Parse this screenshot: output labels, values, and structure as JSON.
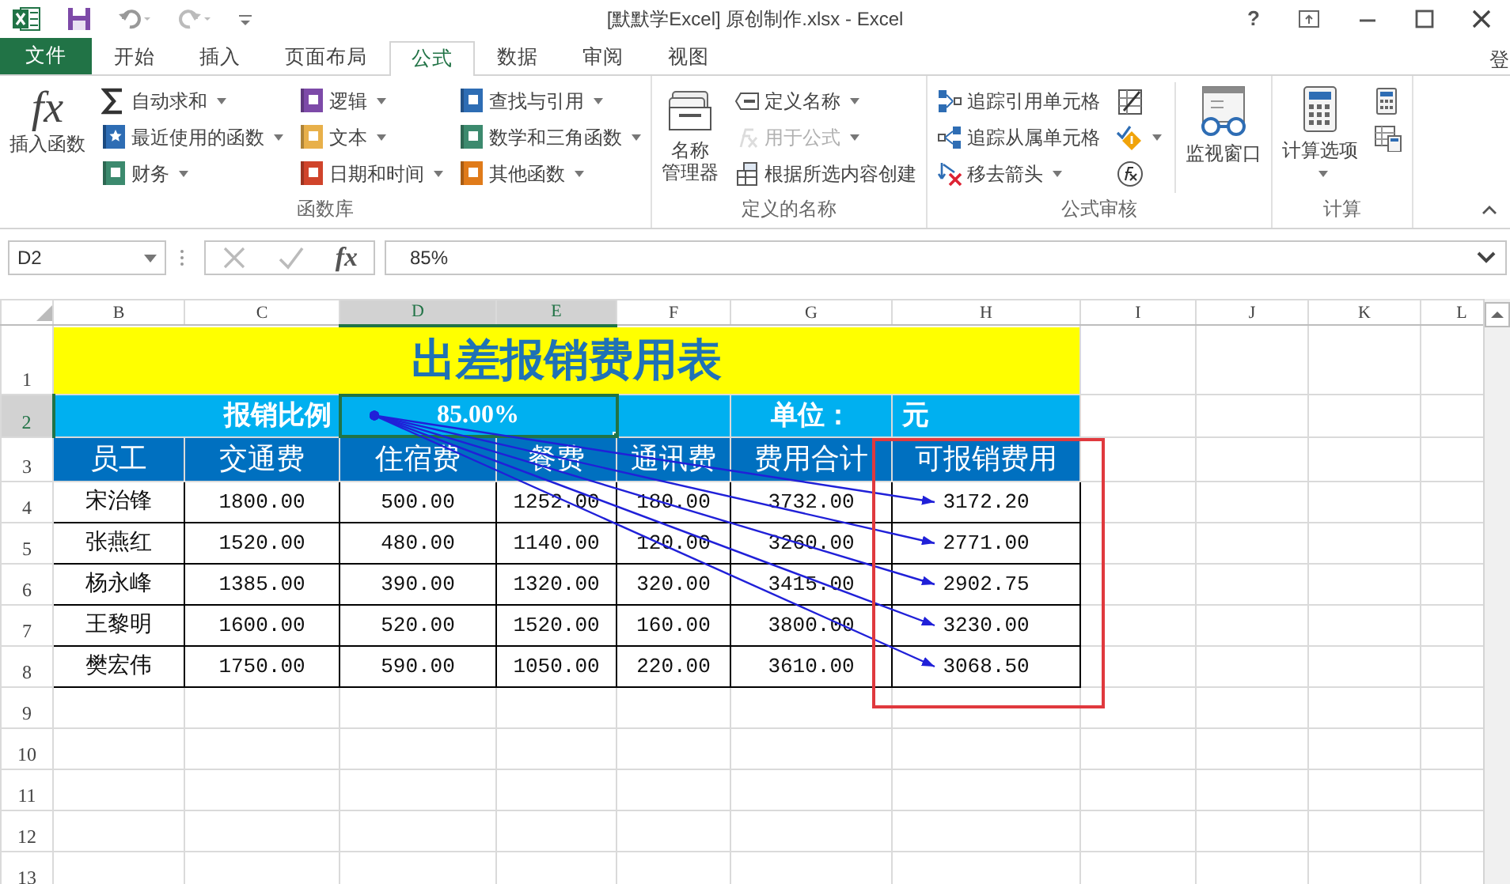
{
  "window": {
    "title": "[默默学Excel] 原创制作.xlsx - Excel",
    "help": "?",
    "account": "登"
  },
  "tabs": [
    {
      "label": "文件",
      "kind": "file",
      "selected": false
    },
    {
      "label": "开始",
      "kind": "tab",
      "selected": false
    },
    {
      "label": "插入",
      "kind": "tab",
      "selected": false
    },
    {
      "label": "页面布局",
      "kind": "tab",
      "selected": false
    },
    {
      "label": "公式",
      "kind": "tab",
      "selected": true
    },
    {
      "label": "数据",
      "kind": "tab",
      "selected": false
    },
    {
      "label": "审阅",
      "kind": "tab",
      "selected": false
    },
    {
      "label": "视图",
      "kind": "tab",
      "selected": false
    }
  ],
  "ribbon": {
    "groups": [
      {
        "label": "函数库",
        "blocks": [
          {
            "kind": "large",
            "glyph": "fx",
            "lines": [
              "插入函数"
            ],
            "dropdown": false
          },
          {
            "kind": "stack",
            "items": [
              {
                "label": "自动求和",
                "dropdown": true,
                "disabled": false
              },
              {
                "label": "最近使用的函数",
                "dropdown": true,
                "disabled": false
              },
              {
                "label": "财务",
                "dropdown": true,
                "disabled": false
              }
            ]
          },
          {
            "kind": "stack",
            "items": [
              {
                "label": "逻辑",
                "dropdown": true,
                "disabled": false
              },
              {
                "label": "文本",
                "dropdown": true,
                "disabled": false
              },
              {
                "label": "日期和时间",
                "dropdown": true,
                "disabled": false
              }
            ]
          },
          {
            "kind": "stack",
            "items": [
              {
                "label": "查找与引用",
                "dropdown": true,
                "disabled": false
              },
              {
                "label": "数学和三角函数",
                "dropdown": true,
                "disabled": false
              },
              {
                "label": "其他函数",
                "dropdown": true,
                "disabled": false
              }
            ]
          }
        ]
      },
      {
        "label": "定义的名称",
        "blocks": [
          {
            "kind": "large",
            "lines": [
              "名称",
              "管理器"
            ],
            "dropdown": false
          },
          {
            "kind": "stack",
            "items": [
              {
                "label": "定义名称",
                "dropdown": true,
                "disabled": false
              },
              {
                "label": "用于公式",
                "dropdown": true,
                "disabled": true
              },
              {
                "label": "根据所选内容创建",
                "dropdown": false,
                "disabled": false
              }
            ]
          }
        ]
      },
      {
        "label": "公式审核",
        "blocks": [
          {
            "kind": "stack",
            "items": [
              {
                "label": "追踪引用单元格",
                "dropdown": false,
                "disabled": false
              },
              {
                "label": "追踪从属单元格",
                "dropdown": false,
                "disabled": false
              },
              {
                "label": "移去箭头",
                "dropdown": true,
                "disabled": false
              }
            ]
          },
          {
            "kind": "stack",
            "items": [
              {
                "dropdown": false,
                "disabled": false
              },
              {
                "dropdown": true,
                "disabled": false
              },
              {
                "dropdown": false,
                "disabled": false
              }
            ]
          },
          {
            "kind": "large",
            "lines": [
              "监视窗口"
            ],
            "dropdown": false
          }
        ]
      },
      {
        "label": "计算",
        "blocks": [
          {
            "kind": "large",
            "lines": [
              "计算选项"
            ],
            "dropdown": true
          },
          {
            "kind": "stack",
            "items": [
              {
                "dropdown": false,
                "disabled": false
              },
              {
                "dropdown": false,
                "disabled": false
              }
            ]
          }
        ]
      }
    ]
  },
  "formula_bar": {
    "name_box": "D2",
    "function_glyph": "fx",
    "formula": "85%"
  },
  "sheet": {
    "columns": [
      {
        "label": "B",
        "selected": false
      },
      {
        "label": "C",
        "selected": false
      },
      {
        "label": "D",
        "selected": true
      },
      {
        "label": "E",
        "selected": true
      },
      {
        "label": "F",
        "selected": false
      },
      {
        "label": "G",
        "selected": false
      },
      {
        "label": "H",
        "selected": false
      },
      {
        "label": "I",
        "selected": false
      },
      {
        "label": "J",
        "selected": false
      },
      {
        "label": "K",
        "selected": false
      },
      {
        "label": "L",
        "selected": false
      }
    ],
    "rows": [
      {
        "label": "1",
        "selected": false
      },
      {
        "label": "2",
        "selected": true
      },
      {
        "label": "3",
        "selected": false
      },
      {
        "label": "4",
        "selected": false
      },
      {
        "label": "5",
        "selected": false
      },
      {
        "label": "6",
        "selected": false
      },
      {
        "label": "7",
        "selected": false
      },
      {
        "label": "8",
        "selected": false
      },
      {
        "label": "9",
        "selected": false
      },
      {
        "label": "10",
        "selected": false
      },
      {
        "label": "11",
        "selected": false
      },
      {
        "label": "12",
        "selected": false
      },
      {
        "label": "13",
        "selected": false
      }
    ],
    "title": "出差报销费用表",
    "ratio_label": "报销比例",
    "ratio_value": "85.00%",
    "ratio_selected": true,
    "unit_label": "单位：",
    "unit_value": "元",
    "header": [
      "员工",
      "交通费",
      "住宿费",
      "餐费",
      "通讯费",
      "费用合计",
      "可报销费用"
    ],
    "data": [
      {
        "cells": [
          "宋治锋",
          "1800.00",
          "500.00",
          "1252.00",
          "180.00",
          "3732.00",
          "3172.20"
        ],
        "traced": true
      },
      {
        "cells": [
          "张燕红",
          "1520.00",
          "480.00",
          "1140.00",
          "120.00",
          "3260.00",
          "2771.00"
        ],
        "traced": true
      },
      {
        "cells": [
          "杨永峰",
          "1385.00",
          "390.00",
          "1320.00",
          "320.00",
          "3415.00",
          "2902.75"
        ],
        "traced": true
      },
      {
        "cells": [
          "王黎明",
          "1600.00",
          "520.00",
          "1520.00",
          "160.00",
          "3800.00",
          "3230.00"
        ],
        "traced": true
      },
      {
        "cells": [
          "樊宏伟",
          "1750.00",
          "590.00",
          "1050.00",
          "220.00",
          "3610.00",
          "3068.50"
        ],
        "traced": true
      }
    ],
    "callout_box": true
  }
}
